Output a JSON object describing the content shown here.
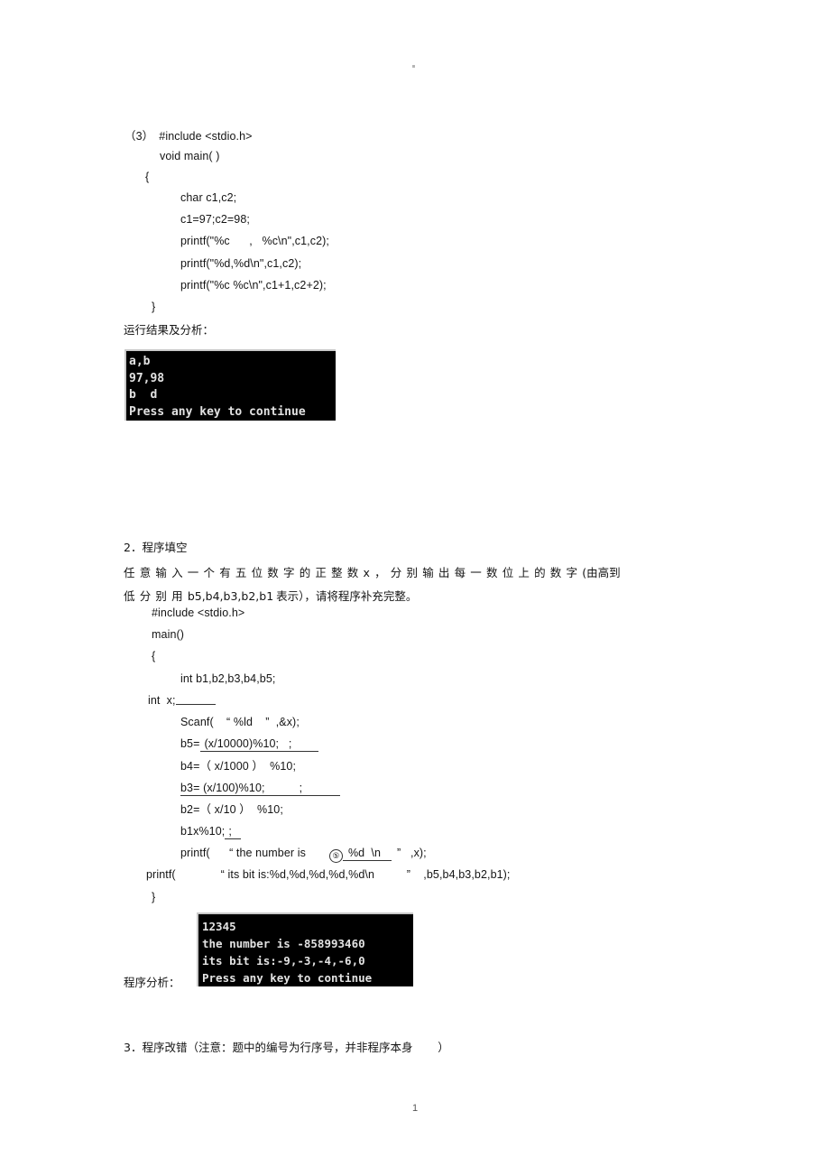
{
  "page": {
    "top_mark": "·",
    "footer_page_number": "1"
  },
  "section3_code": {
    "label": "（3）",
    "lines": [
      "#include <stdio.h>",
      "void main( )",
      "{",
      "char c1,c2;",
      "c1=97;c2=98;",
      "printf(\"%c      ,   %c\\n\",c1,c2);",
      "printf(\"%d,%d\\n\",c1,c2);",
      "printf(\"%c %c\\n\",c1+1,c2+2);",
      "}"
    ]
  },
  "result_label": "运行结果及分析：",
  "console1": {
    "lines": [
      "a,b",
      "97,98",
      "b  d",
      "Press any key to continue"
    ]
  },
  "section2": {
    "heading": "2．程序填空",
    "paragraph_line1_spaced": "任意输入一个有五位数字的正整数x，分别输出每一数位上的数字",
    "paragraph_line1_tail": "(由高到",
    "paragraph_line2_spaced": "低分别用",
    "paragraph_line2_mid": "b5,b4,b3,b2,b1",
    "paragraph_line2_tail": "表示），请将程序补充完整。",
    "code": {
      "l1": "#include <stdio.h>",
      "l2": "main()",
      "l3": "{",
      "l4": "int b1,b2,b3,b4,b5;",
      "l5_pre": "int  x;",
      "l6": "Scanf(    “ %ld    ”  ,&x);",
      "l7_pre": "b5=",
      "l7_fill": "(x/10000)%10;   ;",
      "l8": "b4=（ x/1000 ）  %10;",
      "l9_pre": "b3= (x/100)%10;",
      "l9_fill": ";",
      "l10": "b2=（ x/10 ）  %10;",
      "l11_pre": "b1x%10;",
      "l11_fill": ";",
      "l12_pre": "printf(      “ the number is",
      "l12_circle": "⑤",
      "l12_fill": "%d  \\n",
      "l12_post": "”   ,x);",
      "l13": "printf(              “ its bit is:%d,%d,%d,%d,%d\\n          ”    ,b5,b4,b3,b2,b1);",
      "l14": "}"
    }
  },
  "console2": {
    "lines": [
      "12345",
      "the number is -858993460",
      "its bit is:-9,-3,-4,-6,0",
      "Press any key to continue"
    ]
  },
  "analysis_label": "程序分析：",
  "section3_heading": "3．程序改错（注意：题中的编号为行序号，并非程序本身       ）"
}
